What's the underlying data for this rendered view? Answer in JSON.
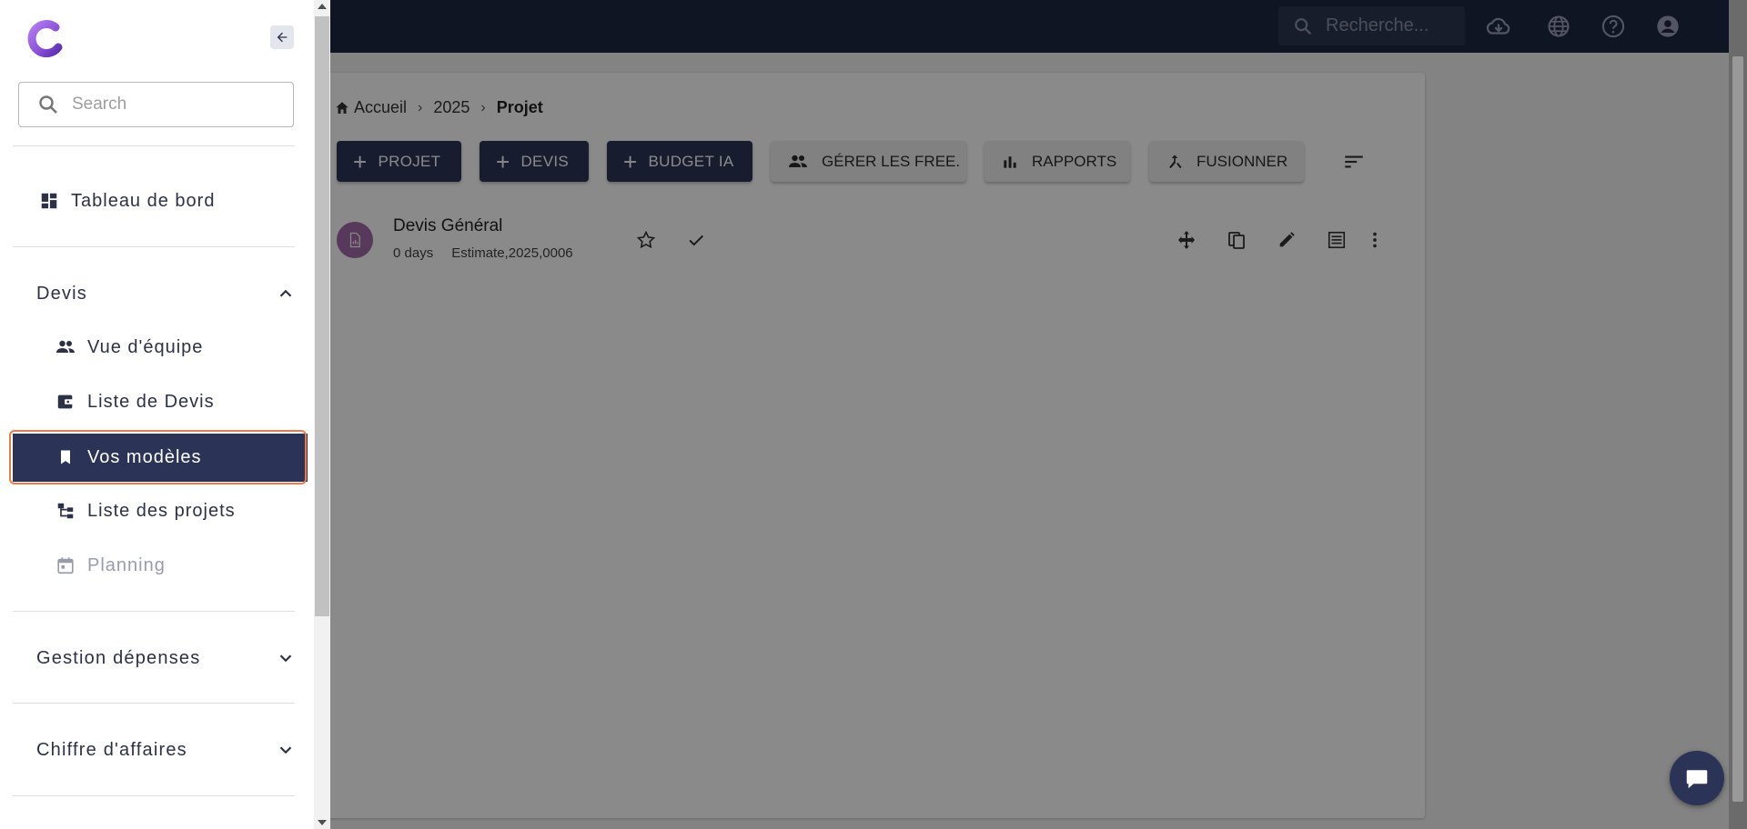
{
  "topbar": {
    "search_placeholder": "Recherche...",
    "icons": [
      "search-icon",
      "cloud-download-icon",
      "globe-icon",
      "help-icon",
      "account-icon"
    ]
  },
  "breadcrumb": {
    "home": "Accueil",
    "year": "2025",
    "current": "Projet"
  },
  "toolbar": {
    "projet": "PROJET",
    "devis": "DEVIS",
    "budget_ia": "BUDGET IA",
    "gerer": "GÉRER LES FREE.",
    "rapports": "RAPPORTS",
    "fusionner": "FUSIONNER"
  },
  "row": {
    "title": "Devis Général",
    "duration": "0 days",
    "reference": "Estimate,2025,0006"
  },
  "sidebar": {
    "search_placeholder": "Search",
    "dashboard": "Tableau de bord",
    "devis_section": "Devis",
    "items": [
      {
        "label": "Vue d'équipe",
        "icon": "group-icon"
      },
      {
        "label": "Liste de Devis",
        "icon": "wallet-icon"
      },
      {
        "label": "Vos modèles",
        "icon": "bookmark-icon"
      },
      {
        "label": "Liste des projets",
        "icon": "tree-icon"
      },
      {
        "label": "Planning",
        "icon": "calendar-icon"
      }
    ],
    "gestion_section": "Gestion dépenses",
    "chiffre_section": "Chiffre d'affaires"
  },
  "colors": {
    "navy": "#1f2744",
    "button_dark": "#2b3456",
    "highlight_border": "#f07a45",
    "logo_purple": "#8a4fd8"
  }
}
